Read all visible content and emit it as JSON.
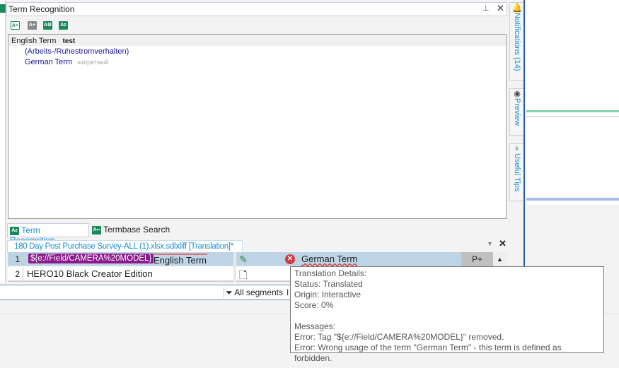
{
  "panel": {
    "title": "Term Recognition"
  },
  "terms": {
    "source_label": "English Term",
    "source_value": "test",
    "synonym": "(Arbeits-/Ruhestromverhalten)",
    "target_label": "German Term",
    "target_status": "запретный"
  },
  "tabs": [
    {
      "label": "Term Recognition"
    },
    {
      "label": "Termbase Search"
    }
  ],
  "document": {
    "tab_label": "180 Day Post Purchase Survey-ALL (1).xlsx.sdlxliff [Translation]*"
  },
  "segments": [
    {
      "num": "1",
      "tag": "${e://Field/CAMERA%20MODEL}",
      "source": "English Term",
      "target": "German Term",
      "match": "P+"
    },
    {
      "num": "2",
      "source": "HERO10 Black Creator Edition",
      "target": ""
    }
  ],
  "status_bar": {
    "filter": "All segments",
    "extra": "I"
  },
  "tooltip": {
    "lines": [
      "Translation Details:",
      "Status: Translated",
      "Origin: Interactive",
      "Score: 0%",
      "",
      "Messages:",
      "Error: Tag \"${e://Field/CAMERA%20MODEL}\" removed.",
      "Error: Wrong usage of the term \"German Term\" - this term is defined as forbidden."
    ]
  },
  "sidebar": [
    {
      "label": "Notifications (14)"
    },
    {
      "label": "Preview"
    },
    {
      "label": "Useful Tips"
    }
  ],
  "colors": {
    "accent": "#1a8fd0",
    "tag": "#8b1a8b",
    "selected_row": "#bcd4e6",
    "error": "#d9363e"
  }
}
